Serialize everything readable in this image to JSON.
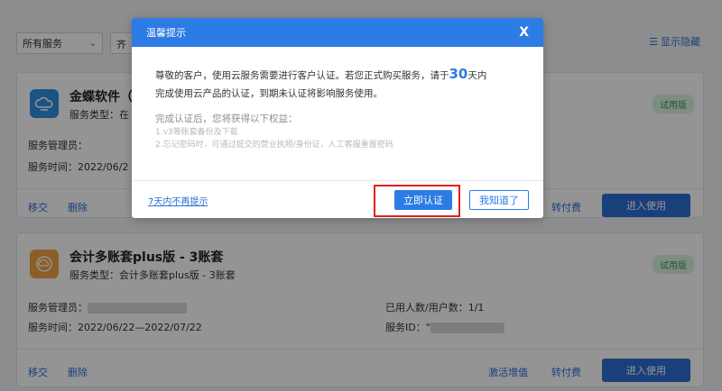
{
  "filter": {
    "service_select": "所有服务",
    "second_select": "齐"
  },
  "toolbar": {
    "toggle_hidden": "显示隐藏"
  },
  "cards": [
    {
      "title": "金蝶软件（C",
      "service_type_label": "服务类型：在",
      "badge": "试用版",
      "manager_label": "服务管理员：",
      "time_label": "服务时间：2022/06/2",
      "actions": {
        "transfer": "移交",
        "delete": "删除",
        "pay": "转付费",
        "enter": "进入使用"
      }
    },
    {
      "title": "会计多账套plus版 - 3账套",
      "service_type_label": "服务类型：会计多账套plus版 - 3账套",
      "badge": "试用版",
      "manager_label": "服务管理员：",
      "time_label": "服务时间：2022/06/22—2022/07/22",
      "users_label": "已用人数/用户数：1/1",
      "service_id_label": "服务ID：",
      "service_id_prefix": "\"",
      "actions": {
        "transfer": "移交",
        "delete": "删除",
        "activate": "激活增值",
        "pay": "转付费",
        "enter": "进入使用"
      }
    }
  ],
  "modal": {
    "title": "温馨提示",
    "close": "X",
    "notice_part1": "尊敬的客户，使用云服务需要进行客户认证。若您正式购买服务，请于",
    "notice_days": "30",
    "notice_part2": "天内",
    "notice_line2": "完成使用云产品的认证，到期未认证将影响服务使用。",
    "benefits_title": "完成认证后，您将获得以下权益：",
    "benefits": [
      "1.v3等账套备份及下载",
      "2.忘记密码时，可通过提交的营业执照/身份证，人工客服重置密码"
    ],
    "no_remind": "7天内不再提示",
    "verify": "立即认证",
    "know": "我知道了"
  },
  "colors": {
    "primary": "#2d7be5",
    "highlight": "#e02020",
    "badge_bg": "#d9f2df"
  }
}
